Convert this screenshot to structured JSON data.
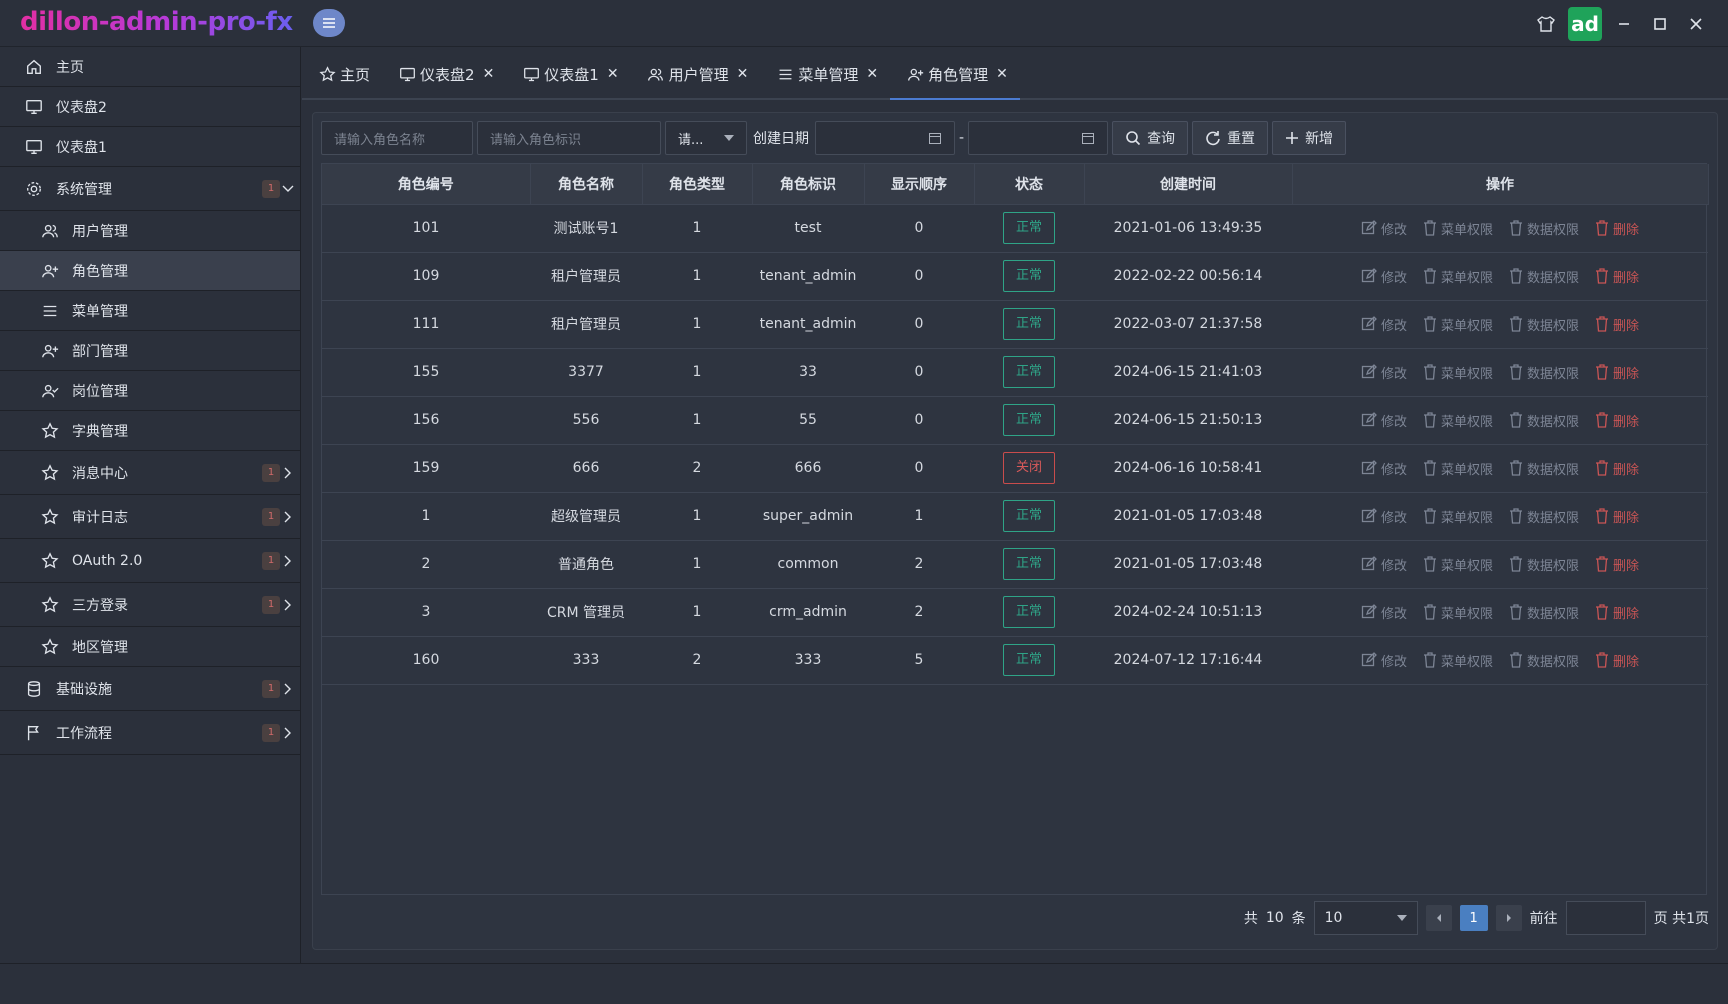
{
  "header": {
    "brand": "dillon-admin-pro-fx",
    "avatar_text": "ad"
  },
  "sidebar": {
    "items": [
      {
        "label": "主页",
        "icon": "home-icon",
        "level": "top"
      },
      {
        "label": "仪表盘2",
        "icon": "monitor-icon",
        "level": "top"
      },
      {
        "label": "仪表盘1",
        "icon": "monitor-icon",
        "level": "top"
      },
      {
        "label": "系统管理",
        "icon": "gear-icon",
        "level": "top",
        "badge": "1",
        "expanded": true
      },
      {
        "label": "用户管理",
        "icon": "users-icon",
        "level": "sub"
      },
      {
        "label": "角色管理",
        "icon": "user-plus-icon",
        "level": "sub",
        "active": true
      },
      {
        "label": "菜单管理",
        "icon": "menu-icon",
        "level": "sub"
      },
      {
        "label": "部门管理",
        "icon": "user-plus-icon",
        "level": "sub"
      },
      {
        "label": "岗位管理",
        "icon": "user-check-icon",
        "level": "sub"
      },
      {
        "label": "字典管理",
        "icon": "star-icon",
        "level": "sub"
      },
      {
        "label": "消息中心",
        "icon": "star-icon",
        "level": "sub",
        "badge": "1"
      },
      {
        "label": "审计日志",
        "icon": "star-icon",
        "level": "sub",
        "badge": "1"
      },
      {
        "label": "OAuth 2.0",
        "icon": "star-icon",
        "level": "sub",
        "badge": "1"
      },
      {
        "label": "三方登录",
        "icon": "star-icon",
        "level": "sub",
        "badge": "1"
      },
      {
        "label": "地区管理",
        "icon": "star-icon",
        "level": "sub"
      },
      {
        "label": "基础设施",
        "icon": "database-icon",
        "level": "top",
        "badge": "1"
      },
      {
        "label": "工作流程",
        "icon": "flag-icon",
        "level": "top",
        "badge": "1"
      }
    ]
  },
  "tabs": [
    {
      "label": "主页",
      "icon": "star-icon",
      "closable": false
    },
    {
      "label": "仪表盘2",
      "icon": "monitor-icon",
      "closable": true
    },
    {
      "label": "仪表盘1",
      "icon": "monitor-icon",
      "closable": true
    },
    {
      "label": "用户管理",
      "icon": "users-icon",
      "closable": true
    },
    {
      "label": "菜单管理",
      "icon": "menu-icon",
      "closable": true
    },
    {
      "label": "角色管理",
      "icon": "user-plus-icon",
      "closable": true,
      "active": true
    }
  ],
  "toolbar": {
    "role_name_placeholder": "请输入角色名称",
    "role_key_placeholder": "请输入角色标识",
    "status_select": "请...",
    "date_label": "创建日期",
    "date_sep": "-",
    "query_label": "查询",
    "reset_label": "重置",
    "add_label": "新增"
  },
  "table": {
    "columns": [
      "角色编号",
      "角色名称",
      "角色类型",
      "角色标识",
      "显示顺序",
      "状态",
      "创建时间",
      "操作"
    ],
    "ops": {
      "edit": "修改",
      "menu_perm": "菜单权限",
      "data_perm": "数据权限",
      "delete": "删除"
    },
    "rows": [
      {
        "id": "101",
        "name": "测试账号1",
        "type": "1",
        "key": "test",
        "order": "0",
        "status": "正常",
        "created": "2021-01-06 13:49:35"
      },
      {
        "id": "109",
        "name": "租户管理员",
        "type": "1",
        "key": "tenant_admin",
        "order": "0",
        "status": "正常",
        "created": "2022-02-22 00:56:14"
      },
      {
        "id": "111",
        "name": "租户管理员",
        "type": "1",
        "key": "tenant_admin",
        "order": "0",
        "status": "正常",
        "created": "2022-03-07 21:37:58"
      },
      {
        "id": "155",
        "name": "3377",
        "type": "1",
        "key": "33",
        "order": "0",
        "status": "正常",
        "created": "2024-06-15 21:41:03"
      },
      {
        "id": "156",
        "name": "556",
        "type": "1",
        "key": "55",
        "order": "0",
        "status": "正常",
        "created": "2024-06-15 21:50:13"
      },
      {
        "id": "159",
        "name": "666",
        "type": "2",
        "key": "666",
        "order": "0",
        "status": "关闭",
        "created": "2024-06-16 10:58:41"
      },
      {
        "id": "1",
        "name": "超级管理员",
        "type": "1",
        "key": "super_admin",
        "order": "1",
        "status": "正常",
        "created": "2021-01-05 17:03:48"
      },
      {
        "id": "2",
        "name": "普通角色",
        "type": "1",
        "key": "common",
        "order": "2",
        "status": "正常",
        "created": "2021-01-05 17:03:48"
      },
      {
        "id": "3",
        "name": "CRM 管理员",
        "type": "1",
        "key": "crm_admin",
        "order": "2",
        "status": "正常",
        "created": "2024-02-24 10:51:13"
      },
      {
        "id": "160",
        "name": "333",
        "type": "2",
        "key": "333",
        "order": "5",
        "status": "正常",
        "created": "2024-07-12 17:16:44"
      }
    ]
  },
  "pagination": {
    "total_prefix": "共",
    "total": "10",
    "total_suffix": "条",
    "page_size": "10",
    "current_page": "1",
    "goto_label": "前往",
    "pages_text": "页 共1页"
  },
  "colors": {
    "accent": "#4a7fc1",
    "ok": "#2fa487",
    "danger": "#d85a5a"
  }
}
